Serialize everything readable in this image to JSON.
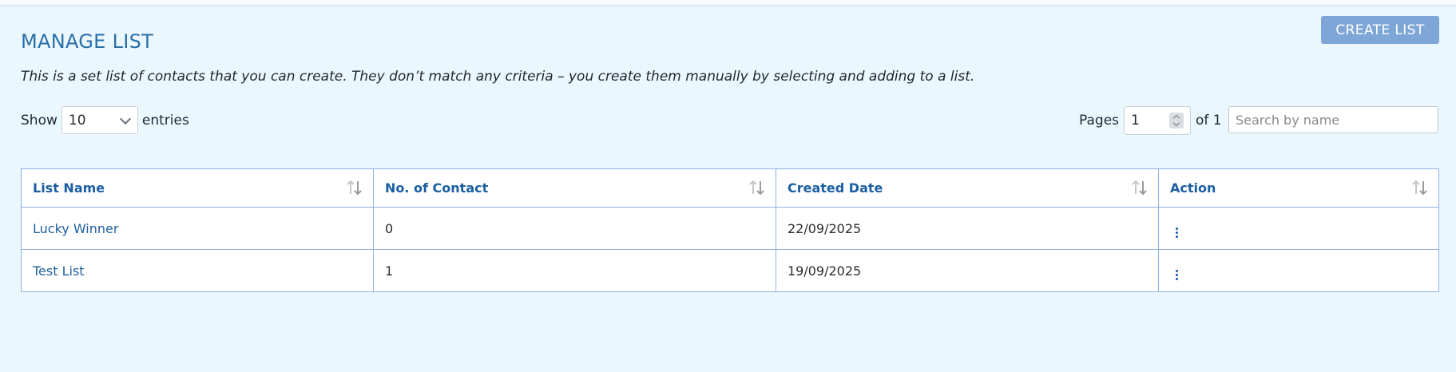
{
  "page": {
    "title": "MANAGE LIST",
    "description": "This is a set list of contacts that you can create. They don’t match any criteria – you create them manually by selecting and adding to a list.",
    "create_button_label": "CREATE LIST"
  },
  "controls": {
    "show_label": "Show",
    "entries_value": "10",
    "entries_label": "entries",
    "pages_label": "Pages",
    "page_value": "1",
    "page_total": "of 1",
    "search_placeholder": "Search by name"
  },
  "table": {
    "columns": [
      {
        "label": "List Name"
      },
      {
        "label": "No. of Contact"
      },
      {
        "label": "Created Date"
      },
      {
        "label": "Action"
      }
    ],
    "rows": [
      {
        "name": "Lucky Winner",
        "contacts": "0",
        "created": "22/09/2025"
      },
      {
        "name": "Test List",
        "contacts": "1",
        "created": "19/09/2025"
      }
    ]
  },
  "icons": {
    "sort": "sort-icon",
    "action": "more-vertical-icon",
    "dropdown": "chevron-down-icon"
  },
  "colors": {
    "background": "#eaf7fd",
    "title": "#2b6fa8",
    "button": "#7ea6d7",
    "table_border": "#8fb0e7",
    "link": "#1d5f9e"
  }
}
